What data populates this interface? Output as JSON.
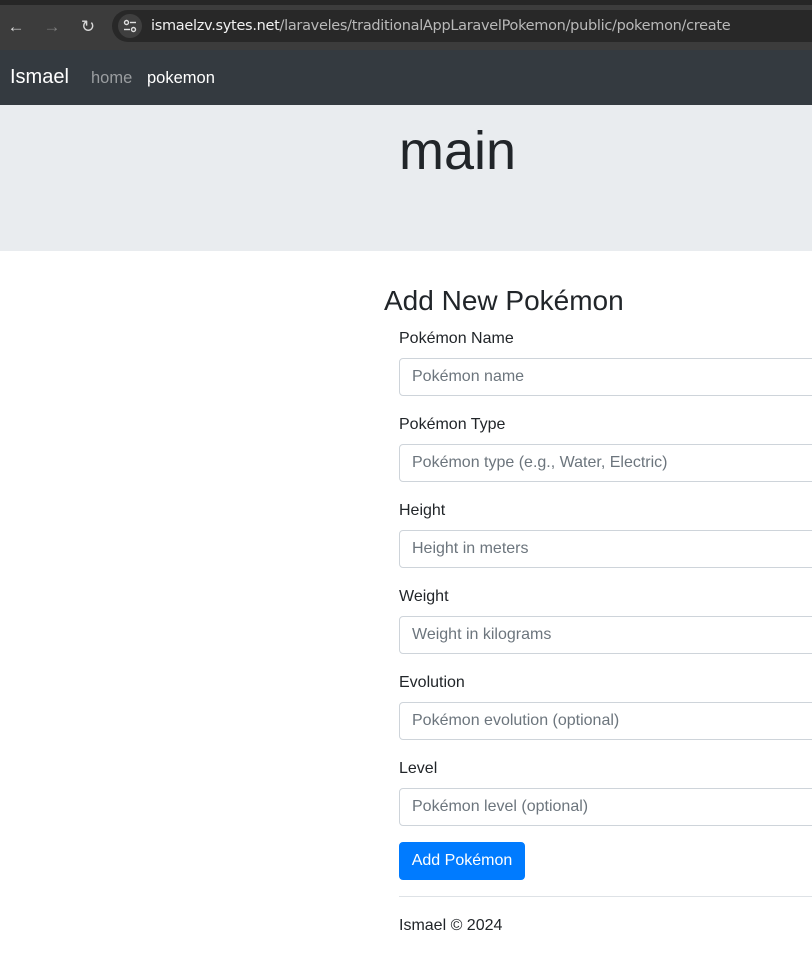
{
  "browser": {
    "back_icon": "←",
    "forward_icon": "→",
    "reload_icon": "↻",
    "url_host": "ismaelzv.sytes.net",
    "url_path": "/laraveles/traditionalAppLaravelPokemon/public/pokemon/create"
  },
  "navbar": {
    "brand": "Ismael",
    "links": [
      {
        "label": "home",
        "active": false
      },
      {
        "label": "pokemon",
        "active": true
      }
    ]
  },
  "jumbotron": {
    "title": "main"
  },
  "form": {
    "heading": "Add New Pokémon",
    "fields": [
      {
        "label": "Pokémon Name",
        "placeholder": "Pokémon name",
        "value": ""
      },
      {
        "label": "Pokémon Type",
        "placeholder": "Pokémon type (e.g., Water, Electric)",
        "value": ""
      },
      {
        "label": "Height",
        "placeholder": "Height in meters",
        "value": ""
      },
      {
        "label": "Weight",
        "placeholder": "Weight in kilograms",
        "value": ""
      },
      {
        "label": "Evolution",
        "placeholder": "Pokémon evolution (optional)",
        "value": ""
      },
      {
        "label": "Level",
        "placeholder": "Pokémon level (optional)",
        "value": ""
      }
    ],
    "submit_label": "Add Pokémon"
  },
  "footer": {
    "text": "Ismael © 2024"
  },
  "colors": {
    "navbar_bg": "#343a40",
    "jumbotron_bg": "#e9ecef",
    "primary_button": "#007bff"
  }
}
